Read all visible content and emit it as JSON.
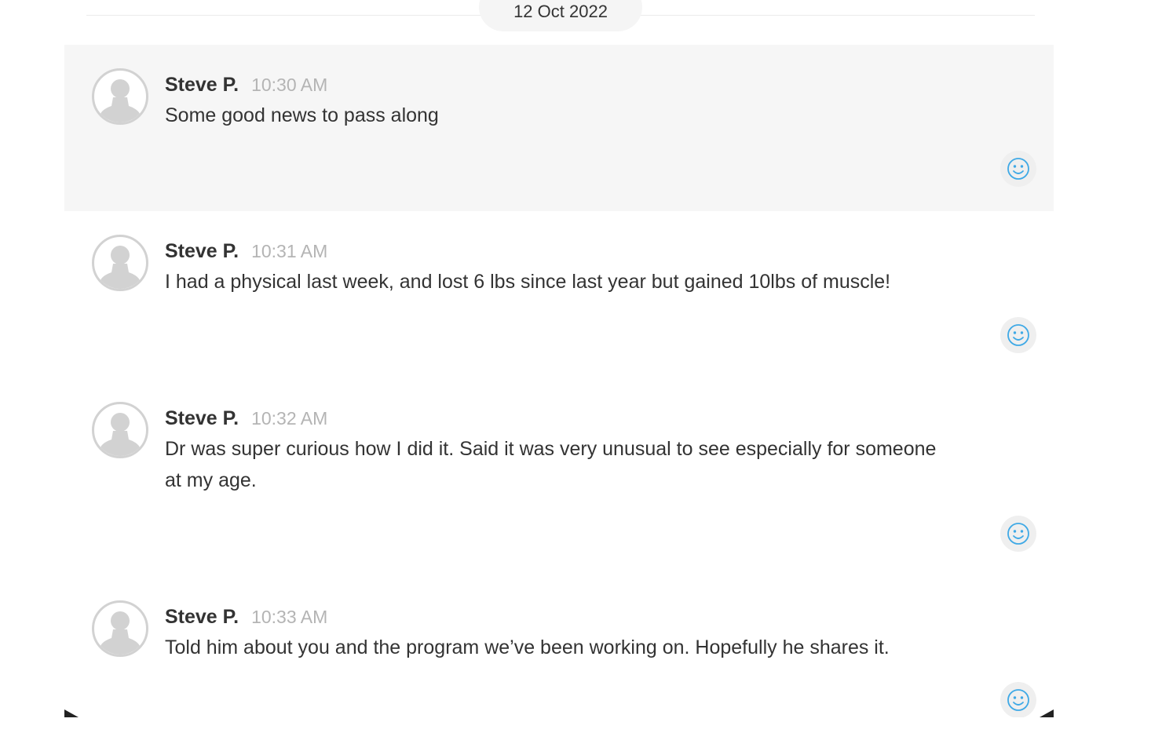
{
  "date_divider": {
    "label": "12 Oct 2022"
  },
  "messages": [
    {
      "author": "Steve P.",
      "time": "10:30 AM",
      "text": "Some good news to pass along",
      "highlighted": true
    },
    {
      "author": "Steve P.",
      "time": "10:31 AM",
      "text": "I had a physical last week, and lost 6 lbs since last year but gained 10lbs of muscle!",
      "highlighted": false
    },
    {
      "author": "Steve P.",
      "time": "10:32 AM",
      "text": "Dr was super curious how I did it. Said it was very unusual to see especially for someone at my age.",
      "highlighted": false
    },
    {
      "author": "Steve P.",
      "time": "10:33 AM",
      "text": "Told him about you and the program we’ve been working on. Hopefully he shares it.",
      "highlighted": false
    }
  ],
  "icons": {
    "avatar": "default-user-avatar-icon",
    "reaction": "smiley-face-icon"
  },
  "colors": {
    "highlight_background": "#f6f6f6",
    "timestamp": "#b4b4b4",
    "reaction_icon": "#3fa9e6",
    "avatar_placeholder": "#d2d2d2"
  }
}
